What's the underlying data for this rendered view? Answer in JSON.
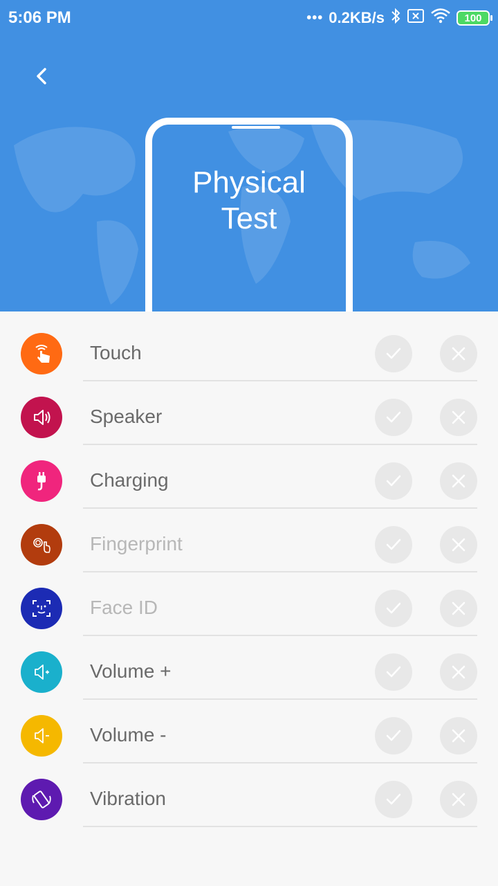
{
  "status_bar": {
    "time": "5:06 PM",
    "dots": "•••",
    "speed": "0.2KB/s",
    "battery": "100"
  },
  "header": {
    "title_line1": "Physical",
    "title_line2": "Test"
  },
  "tests": [
    {
      "label": "Touch",
      "color": "#ff6a13",
      "icon": "touch-icon",
      "enabled": true
    },
    {
      "label": "Speaker",
      "color": "#c2134e",
      "icon": "speaker-icon",
      "enabled": true
    },
    {
      "label": "Charging",
      "color": "#f0257d",
      "icon": "charging-plug-icon",
      "enabled": true
    },
    {
      "label": "Fingerprint",
      "color": "#b23c0e",
      "icon": "fingerprint-icon",
      "enabled": false
    },
    {
      "label": "Face ID",
      "color": "#1c2bb4",
      "icon": "face-id-icon",
      "enabled": false
    },
    {
      "label": "Volume +",
      "color": "#1ab0cc",
      "icon": "volume-up-icon",
      "enabled": true
    },
    {
      "label": "Volume -",
      "color": "#f5b800",
      "icon": "volume-down-icon",
      "enabled": true
    },
    {
      "label": "Vibration",
      "color": "#5e1ab0",
      "icon": "vibration-icon",
      "enabled": true
    }
  ]
}
